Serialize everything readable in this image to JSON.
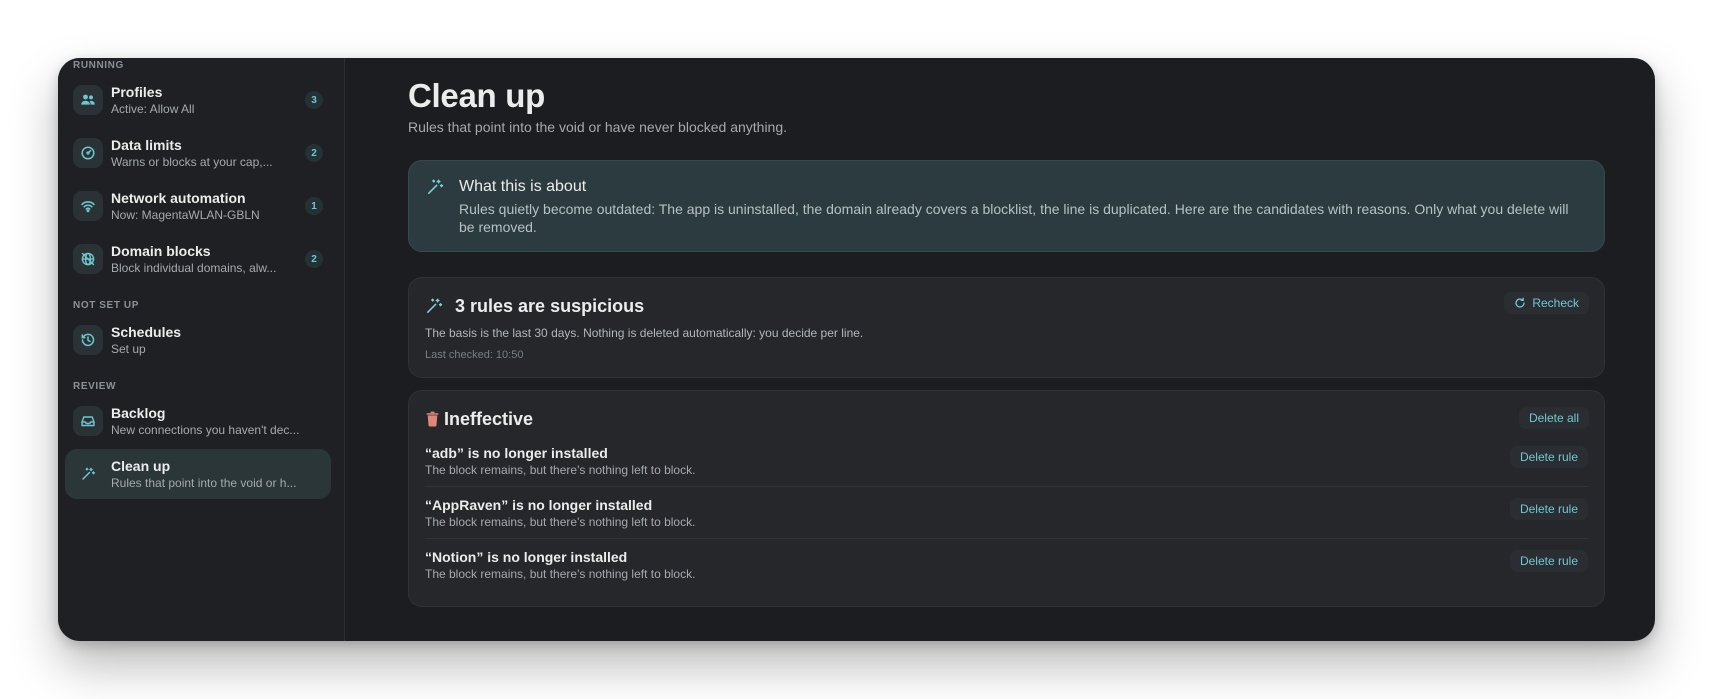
{
  "sidebar": {
    "sections": {
      "running": "RUNNING",
      "not_set_up": "NOT SET UP",
      "review": "REVIEW"
    },
    "items": [
      {
        "title": "Profiles",
        "subtitle": "Active: Allow All",
        "badge": "3",
        "icon": "people-icon"
      },
      {
        "title": "Data limits",
        "subtitle": "Warns or blocks at your cap,...",
        "badge": "2",
        "icon": "gauge-icon"
      },
      {
        "title": "Network automation",
        "subtitle": "Now: MagentaWLAN-GBLN",
        "badge": "1",
        "icon": "wifi-icon"
      },
      {
        "title": "Domain blocks",
        "subtitle": "Block individual domains, alw...",
        "badge": "2",
        "icon": "globe-slash-icon"
      },
      {
        "title": "Schedules",
        "subtitle": "Set up",
        "icon": "clock-icon"
      },
      {
        "title": "Backlog",
        "subtitle": "New connections you haven't dec...",
        "icon": "tray-icon"
      },
      {
        "title": "Clean up",
        "subtitle": "Rules that point into the void or h...",
        "icon": "magic-wand-icon",
        "active": true
      }
    ]
  },
  "main": {
    "title": "Clean up",
    "subtitle": "Rules that point into the void or have never blocked anything.",
    "info": {
      "title": "What this is about",
      "body": "Rules quietly become outdated: The app is uninstalled, the domain already covers a blocklist, the line is duplicated. Here are the candidates with reasons. Only what you delete will be removed."
    },
    "suspicious": {
      "title": "3 rules are suspicious",
      "body": "The basis is the last 30 days. Nothing is deleted automatically: you decide per line.",
      "last_checked": "Last checked: 10:50",
      "recheck_label": "Recheck"
    },
    "ineffective": {
      "title": "Ineffective",
      "delete_all_label": "Delete all",
      "rules": [
        {
          "title": "“adb” is no longer installed",
          "subtitle": "The block remains, but there's nothing left to block.",
          "action": "Delete rule"
        },
        {
          "title": "“AppRaven” is no longer installed",
          "subtitle": "The block remains, but there's nothing left to block.",
          "action": "Delete rule"
        },
        {
          "title": "“Notion” is no longer installed",
          "subtitle": "The block remains, but there's nothing left to block.",
          "action": "Delete rule"
        }
      ]
    }
  },
  "colors": {
    "accent": "#71c7d0",
    "danger_icon": "#e0857a",
    "window_bg": "#1c1d20",
    "info_card_bg": "#2b3b3f"
  }
}
